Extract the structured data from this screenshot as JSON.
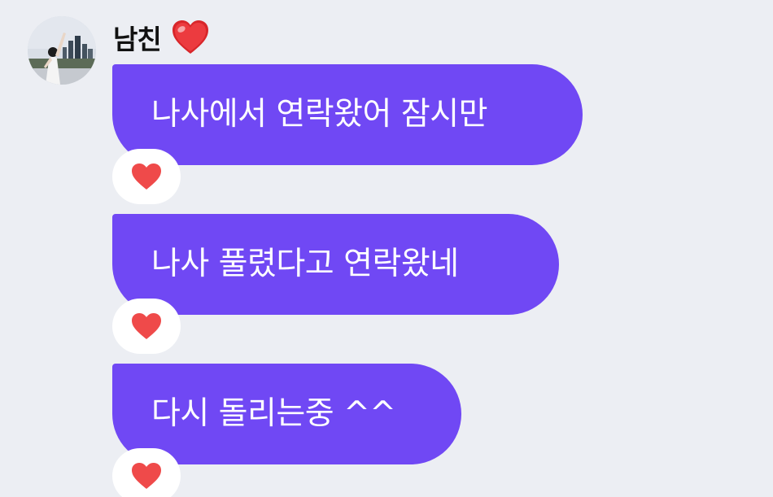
{
  "sender": {
    "name": "남친",
    "emoji": "heart-emoji"
  },
  "messages": [
    {
      "text": "나사에서 연락왔어 잠시만",
      "reaction": "heart-icon"
    },
    {
      "text": "나사 풀렸다고 연락왔네",
      "reaction": "heart-icon"
    },
    {
      "text": "다시 돌리는중 ^^",
      "reaction": "heart-icon"
    }
  ],
  "colors": {
    "background": "#eceef3",
    "bubble": "#7048f4",
    "bubble_text": "#ffffff",
    "reaction_background": "#ffffff",
    "heart": "#ef4a4a",
    "name_text": "#111111"
  }
}
